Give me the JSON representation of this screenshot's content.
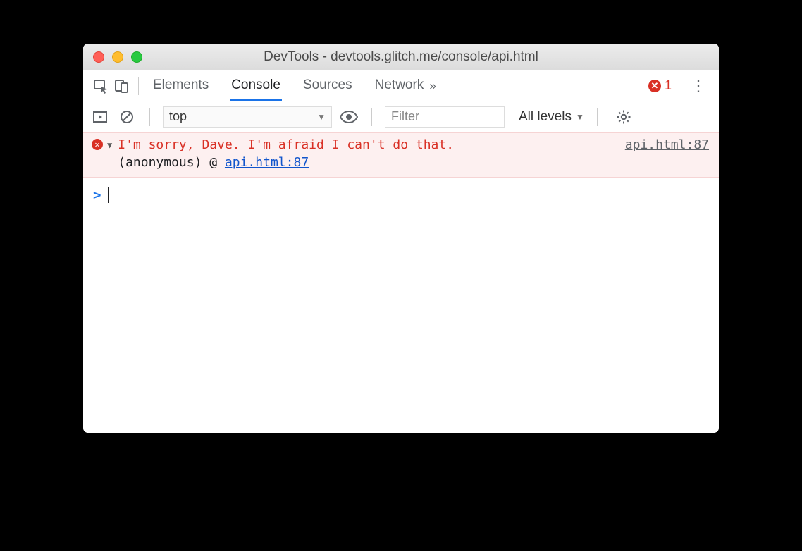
{
  "window": {
    "title": "DevTools - devtools.glitch.me/console/api.html"
  },
  "tabs": {
    "items": [
      "Elements",
      "Console",
      "Sources",
      "Network"
    ],
    "active": "Console",
    "more_glyph": "»",
    "error_count": "1"
  },
  "filterbar": {
    "context": "top",
    "filter_placeholder": "Filter",
    "levels_label": "All levels"
  },
  "log": {
    "error_message": "I'm sorry, Dave. I'm afraid I can't do that.",
    "source_link": "api.html:87",
    "stack_prefix": "(anonymous) @ ",
    "stack_link": "api.html:87"
  },
  "prompt": {
    "caret": ">"
  }
}
